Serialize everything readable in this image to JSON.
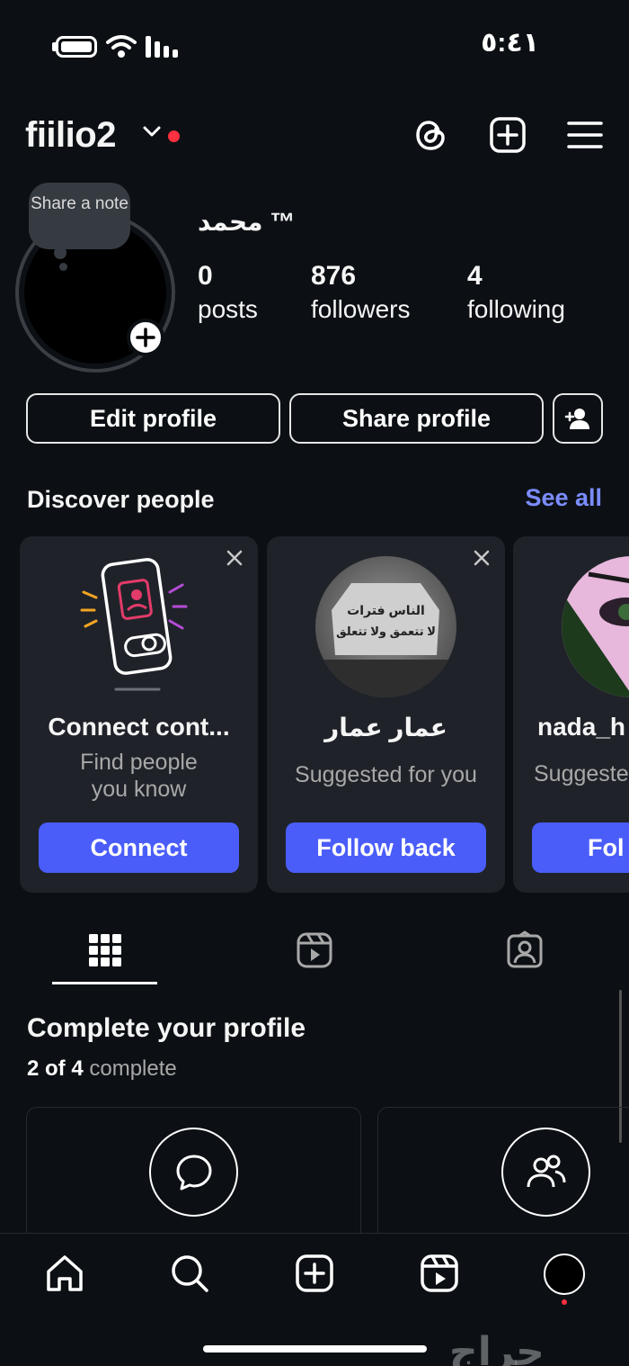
{
  "status_bar": {
    "time": "٥:٤١"
  },
  "header": {
    "username": "fiilio2",
    "icons": [
      "chevron-down-icon",
      "threads-icon",
      "create-icon",
      "menu-icon"
    ]
  },
  "profile": {
    "note_text": "Share a note",
    "display_name": "محمد ™",
    "stats": [
      {
        "value": "0",
        "label": "posts"
      },
      {
        "value": "876",
        "label": "followers"
      },
      {
        "value": "4",
        "label": "following"
      }
    ],
    "buttons": {
      "edit": "Edit profile",
      "share": "Share profile"
    }
  },
  "discover": {
    "title": "Discover people",
    "see_all": "See all",
    "cards": [
      {
        "title": "Connect cont...",
        "subtitle": "Find people you know",
        "subtitle_line1": "Find people",
        "subtitle_line2": "you know",
        "button": "Connect"
      },
      {
        "title": "عمار عمار",
        "subtitle": "Suggested for you",
        "button": "Follow back",
        "photo_text_1": "الناس فترات",
        "photo_text_2": "لا تتعمق ولا تتعلق"
      },
      {
        "title": "nada_h",
        "subtitle": "Suggeste",
        "button": "Fol"
      }
    ]
  },
  "tabs": [
    "grid-icon",
    "reels-icon",
    "tagged-icon"
  ],
  "complete_profile": {
    "title": "Complete your profile",
    "progress_bold": "2 of 4",
    "progress_rest": "complete"
  },
  "bottom_nav": [
    "home-icon",
    "search-icon",
    "create-icon",
    "reels-icon",
    "profile-avatar"
  ],
  "watermark": "حراج",
  "colors": {
    "background": "#0c1014",
    "accent": "#4a5df9",
    "link": "#7b8cff",
    "notification": "#ff3040",
    "card": "#1f2329"
  }
}
